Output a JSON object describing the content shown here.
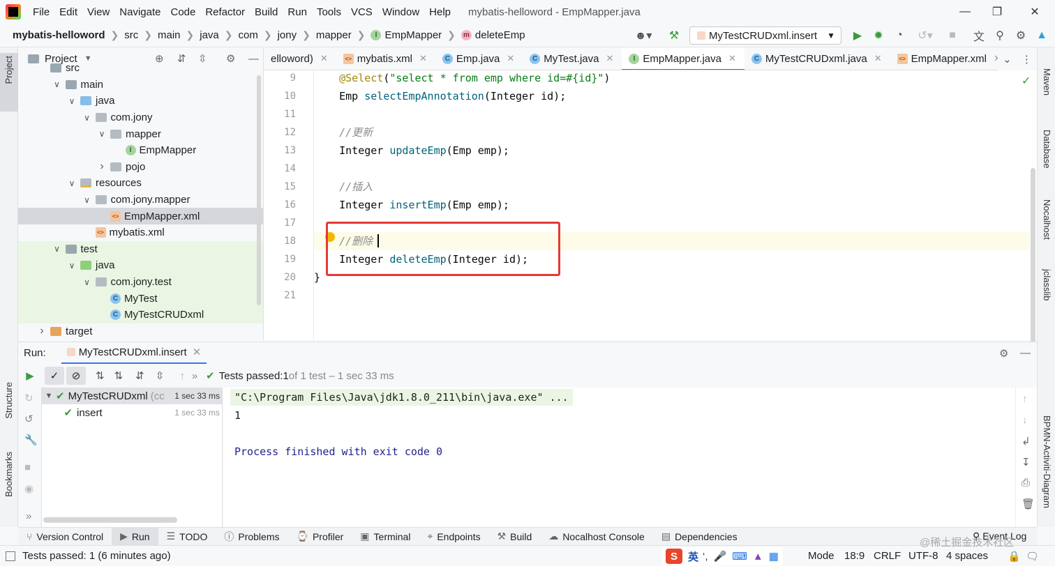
{
  "menubar": {
    "items": [
      "File",
      "Edit",
      "View",
      "Navigate",
      "Code",
      "Refactor",
      "Build",
      "Run",
      "Tools",
      "VCS",
      "Window",
      "Help"
    ],
    "title": "mybatis-helloword - EmpMapper.java"
  },
  "breadcrumb": {
    "project": "mybatis-helloword",
    "parts": [
      "src",
      "main",
      "java",
      "com",
      "jony",
      "mapper"
    ],
    "interface": "EmpMapper",
    "method": "deleteEmp"
  },
  "toolbar": {
    "run_config": "MyTestCRUDxml.insert"
  },
  "project_panel": {
    "title": "Project",
    "tree": [
      {
        "label": "src",
        "indent": 0,
        "icon": "folder"
      },
      {
        "label": "main",
        "indent": 1,
        "icon": "folder",
        "expanded": true
      },
      {
        "label": "java",
        "indent": 2,
        "icon": "folder-blue",
        "expanded": true
      },
      {
        "label": "com.jony",
        "indent": 3,
        "icon": "package",
        "expanded": true
      },
      {
        "label": "mapper",
        "indent": 4,
        "icon": "package",
        "expanded": true
      },
      {
        "label": "EmpMapper",
        "indent": 5,
        "icon": "interface"
      },
      {
        "label": "pojo",
        "indent": 4,
        "icon": "package",
        "collapsed": true
      },
      {
        "label": "resources",
        "indent": 2,
        "icon": "resources",
        "expanded": true
      },
      {
        "label": "com.jony.mapper",
        "indent": 3,
        "icon": "package",
        "expanded": true
      },
      {
        "label": "EmpMapper.xml",
        "indent": 4,
        "icon": "xml",
        "selected": true
      },
      {
        "label": "mybatis.xml",
        "indent": 3,
        "icon": "xml"
      },
      {
        "label": "test",
        "indent": 1,
        "icon": "folder",
        "expanded": true
      },
      {
        "label": "java",
        "indent": 2,
        "icon": "folder-green",
        "expanded": true
      },
      {
        "label": "com.jony.test",
        "indent": 3,
        "icon": "package",
        "expanded": true
      },
      {
        "label": "MyTest",
        "indent": 4,
        "icon": "class"
      },
      {
        "label": "MyTestCRUDxml",
        "indent": 4,
        "icon": "class"
      },
      {
        "label": "target",
        "indent": 0,
        "icon": "folder-orange",
        "collapsed": true
      }
    ]
  },
  "editor": {
    "tabs": [
      {
        "label": "elloword)",
        "icon": "none"
      },
      {
        "label": "mybatis.xml",
        "icon": "xml"
      },
      {
        "label": "Emp.java",
        "icon": "class"
      },
      {
        "label": "MyTest.java",
        "icon": "class"
      },
      {
        "label": "EmpMapper.java",
        "icon": "interface",
        "active": true
      },
      {
        "label": "MyTestCRUDxml.java",
        "icon": "class"
      },
      {
        "label": "EmpMapper.xml",
        "icon": "xml"
      }
    ],
    "lines": [
      {
        "n": "9",
        "parts": [
          [
            "    ",
            ""
          ],
          [
            "@Select",
            "ann"
          ],
          [
            "(",
            ""
          ],
          [
            "\"select * from emp where id=#{id}\"",
            "str"
          ],
          [
            ")",
            ""
          ]
        ]
      },
      {
        "n": "10",
        "parts": [
          [
            "    Emp ",
            ""
          ],
          [
            "selectEmpAnnotation",
            "fn"
          ],
          [
            "(Integer id);",
            ""
          ]
        ]
      },
      {
        "n": "11",
        "parts": []
      },
      {
        "n": "12",
        "parts": [
          [
            "    ",
            ""
          ],
          [
            "//更新",
            "cm"
          ]
        ]
      },
      {
        "n": "13",
        "parts": [
          [
            "    Integer ",
            ""
          ],
          [
            "updateEmp",
            "fn"
          ],
          [
            "(Emp emp);",
            ""
          ]
        ]
      },
      {
        "n": "14",
        "parts": []
      },
      {
        "n": "15",
        "parts": [
          [
            "    ",
            ""
          ],
          [
            "//插入",
            "cm"
          ]
        ]
      },
      {
        "n": "16",
        "parts": [
          [
            "    Integer ",
            ""
          ],
          [
            "insertEmp",
            "fn"
          ],
          [
            "(Emp emp);",
            ""
          ]
        ]
      },
      {
        "n": "17",
        "parts": []
      },
      {
        "n": "18",
        "parts": [
          [
            "    ",
            ""
          ],
          [
            "//删除",
            "cm"
          ]
        ],
        "current": true
      },
      {
        "n": "19",
        "parts": [
          [
            "    Integer ",
            ""
          ],
          [
            "deleteEmp",
            "fn"
          ],
          [
            "(Integer id);",
            ""
          ]
        ]
      },
      {
        "n": "20",
        "parts": [
          [
            "}",
            ""
          ]
        ]
      },
      {
        "n": "21",
        "parts": []
      }
    ]
  },
  "run_panel": {
    "label": "Run:",
    "tab": "MyTestCRUDxml.insert",
    "status_prefix": "Tests passed: ",
    "status_count": "1",
    "status_detail": " of 1 test – 1 sec 33 ms",
    "tree": [
      {
        "label": "MyTestCRUDxml",
        "suffix": "(cc",
        "time": "1 sec 33 ms"
      },
      {
        "label": "insert",
        "time": "1 sec 33 ms"
      }
    ],
    "console": [
      "\"C:\\Program Files\\Java\\jdk1.8.0_211\\bin\\java.exe\" ...",
      "1",
      "",
      "Process finished with exit code 0"
    ]
  },
  "tool_windows": [
    "Version Control",
    "Run",
    "TODO",
    "Problems",
    "Profiler",
    "Terminal",
    "Endpoints",
    "Build",
    "Nocalhost Console",
    "Dependencies"
  ],
  "event_log": "Event Log",
  "left_stripe": [
    "Project",
    "Structure",
    "Bookmarks"
  ],
  "right_stripe": [
    "Maven",
    "Database",
    "Nocalhost",
    "jclasslib",
    "BPMN-Activiti-Diagram"
  ],
  "status_bar": {
    "message": "Tests passed: 1 (6 minutes ago)",
    "mode": "Mode",
    "position": "18:9",
    "line_sep": "CRLF",
    "encoding": "UTF-8",
    "indent": "4 spaces",
    "ime": "英",
    "watermark": "@稀土掘金技术社区"
  }
}
